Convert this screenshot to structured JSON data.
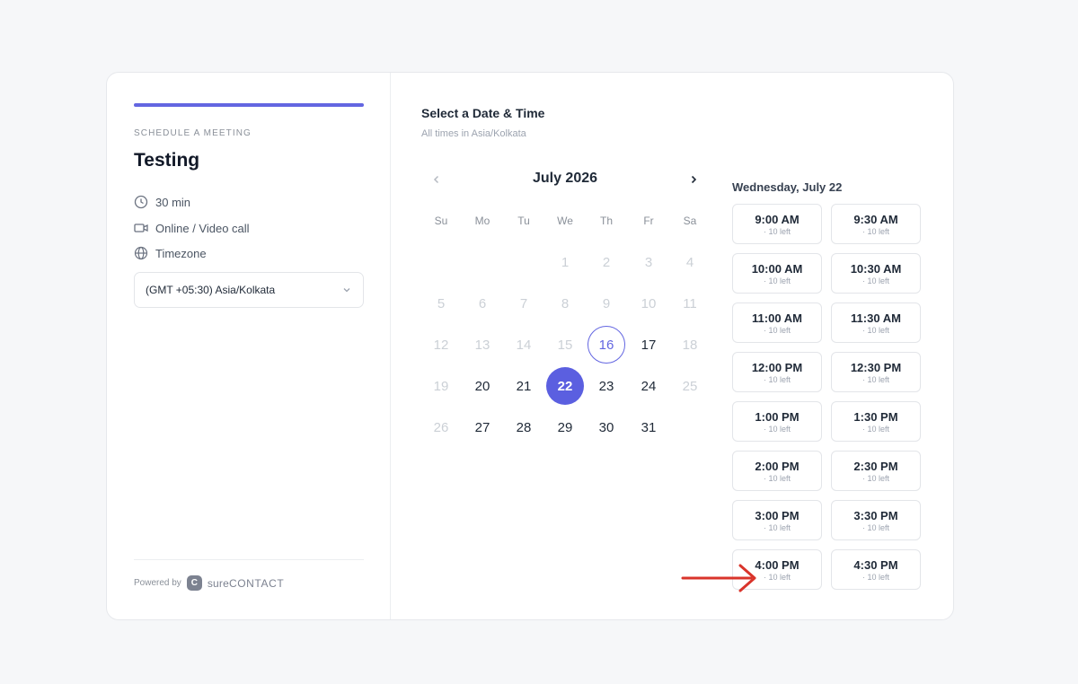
{
  "sidebar": {
    "eyebrow": "SCHEDULE A MEETING",
    "title": "Testing",
    "duration": "30 min",
    "location": "Online / Video call",
    "timezone_label": "Timezone",
    "timezone_value": "(GMT +05:30) Asia/Kolkata",
    "powered_by": "Powered by",
    "brand_logo_letter": "C",
    "brand_prefix": "sure",
    "brand_suffix": "CONTACT"
  },
  "calendar": {
    "heading": "Select a Date & Time",
    "subheading": "All times in Asia/Kolkata",
    "month": "July 2026",
    "weekdays": [
      "Su",
      "Mo",
      "Tu",
      "We",
      "Th",
      "Fr",
      "Sa"
    ],
    "weeks": [
      [
        "",
        "",
        "",
        "1",
        "2",
        "3",
        "4"
      ],
      [
        "5",
        "6",
        "7",
        "8",
        "9",
        "10",
        "11"
      ],
      [
        "12",
        "13",
        "14",
        "15",
        "16",
        "17",
        "18"
      ],
      [
        "19",
        "20",
        "21",
        "22",
        "23",
        "24",
        "25"
      ],
      [
        "26",
        "27",
        "28",
        "29",
        "30",
        "31",
        ""
      ]
    ],
    "available_days": [
      "17",
      "20",
      "21",
      "22",
      "23",
      "24",
      "27",
      "28",
      "29",
      "30",
      "31"
    ],
    "today": "16",
    "selected": "22"
  },
  "slots": {
    "date_label": "Wednesday, July 22",
    "items": [
      {
        "time": "9:00 AM",
        "left": "· 10 left"
      },
      {
        "time": "9:30 AM",
        "left": "· 10 left"
      },
      {
        "time": "10:00 AM",
        "left": "· 10 left"
      },
      {
        "time": "10:30 AM",
        "left": "· 10 left"
      },
      {
        "time": "11:00 AM",
        "left": "· 10 left"
      },
      {
        "time": "11:30 AM",
        "left": "· 10 left"
      },
      {
        "time": "12:00 PM",
        "left": "· 10 left"
      },
      {
        "time": "12:30 PM",
        "left": "· 10 left"
      },
      {
        "time": "1:00 PM",
        "left": "· 10 left"
      },
      {
        "time": "1:30 PM",
        "left": "· 10 left"
      },
      {
        "time": "2:00 PM",
        "left": "· 10 left"
      },
      {
        "time": "2:30 PM",
        "left": "· 10 left"
      },
      {
        "time": "3:00 PM",
        "left": "· 10 left"
      },
      {
        "time": "3:30 PM",
        "left": "· 10 left"
      },
      {
        "time": "4:00 PM",
        "left": "· 10 left"
      },
      {
        "time": "4:30 PM",
        "left": "· 10 left"
      }
    ]
  },
  "colors": {
    "accent": "#6366e1",
    "selected_day": "#5b5fe0",
    "annotation_arrow": "#d9342b"
  }
}
